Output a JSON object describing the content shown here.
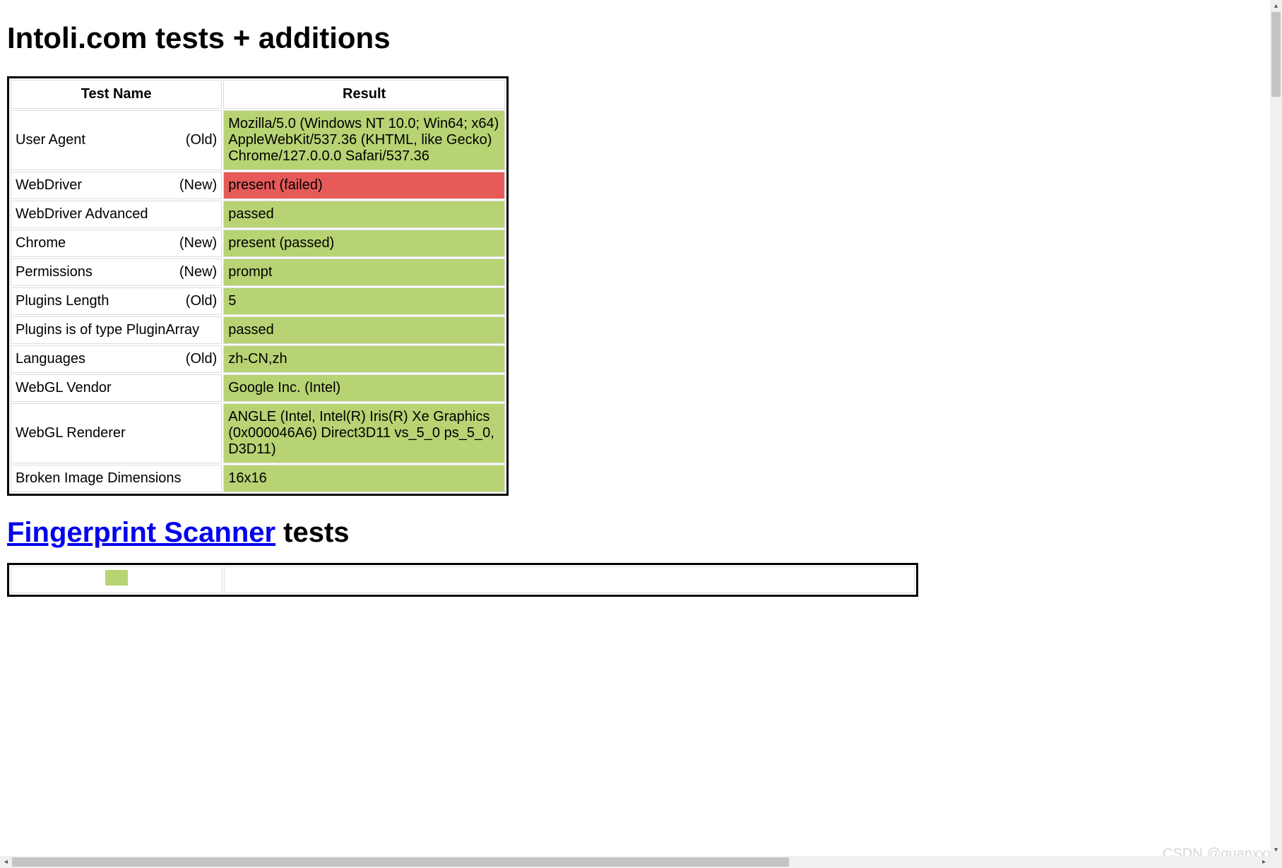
{
  "heading1": "Intoli.com tests + additions",
  "table1": {
    "headers": {
      "name": "Test Name",
      "result": "Result"
    },
    "rows": [
      {
        "name": "User Agent",
        "tag": "(Old)",
        "result": "Mozilla/5.0 (Windows NT 10.0; Win64; x64) AppleWebKit/537.36 (KHTML, like Gecko) Chrome/127.0.0.0 Safari/537.36",
        "status": "pass"
      },
      {
        "name": "WebDriver",
        "tag": "(New)",
        "result": "present (failed)",
        "status": "fail"
      },
      {
        "name": "WebDriver Advanced",
        "tag": "",
        "result": "passed",
        "status": "pass"
      },
      {
        "name": "Chrome",
        "tag": "(New)",
        "result": "present (passed)",
        "status": "pass"
      },
      {
        "name": "Permissions",
        "tag": "(New)",
        "result": "prompt",
        "status": "pass"
      },
      {
        "name": "Plugins Length",
        "tag": "(Old)",
        "result": "5",
        "status": "pass"
      },
      {
        "name": "Plugins is of type PluginArray",
        "tag": "",
        "result": "passed",
        "status": "pass"
      },
      {
        "name": "Languages",
        "tag": "(Old)",
        "result": "zh-CN,zh",
        "status": "pass"
      },
      {
        "name": "WebGL Vendor",
        "tag": "",
        "result": "Google Inc. (Intel)",
        "status": "pass"
      },
      {
        "name": "WebGL Renderer",
        "tag": "",
        "result": "ANGLE (Intel, Intel(R) Iris(R) Xe Graphics (0x000046A6) Direct3D11 vs_5_0 ps_5_0, D3D11)",
        "status": "pass"
      },
      {
        "name": "Broken Image Dimensions",
        "tag": "",
        "result": "16x16",
        "status": "pass"
      }
    ]
  },
  "heading2": {
    "link": "Fingerprint Scanner",
    "rest": " tests"
  },
  "watermark": "CSDN @guanxxx"
}
